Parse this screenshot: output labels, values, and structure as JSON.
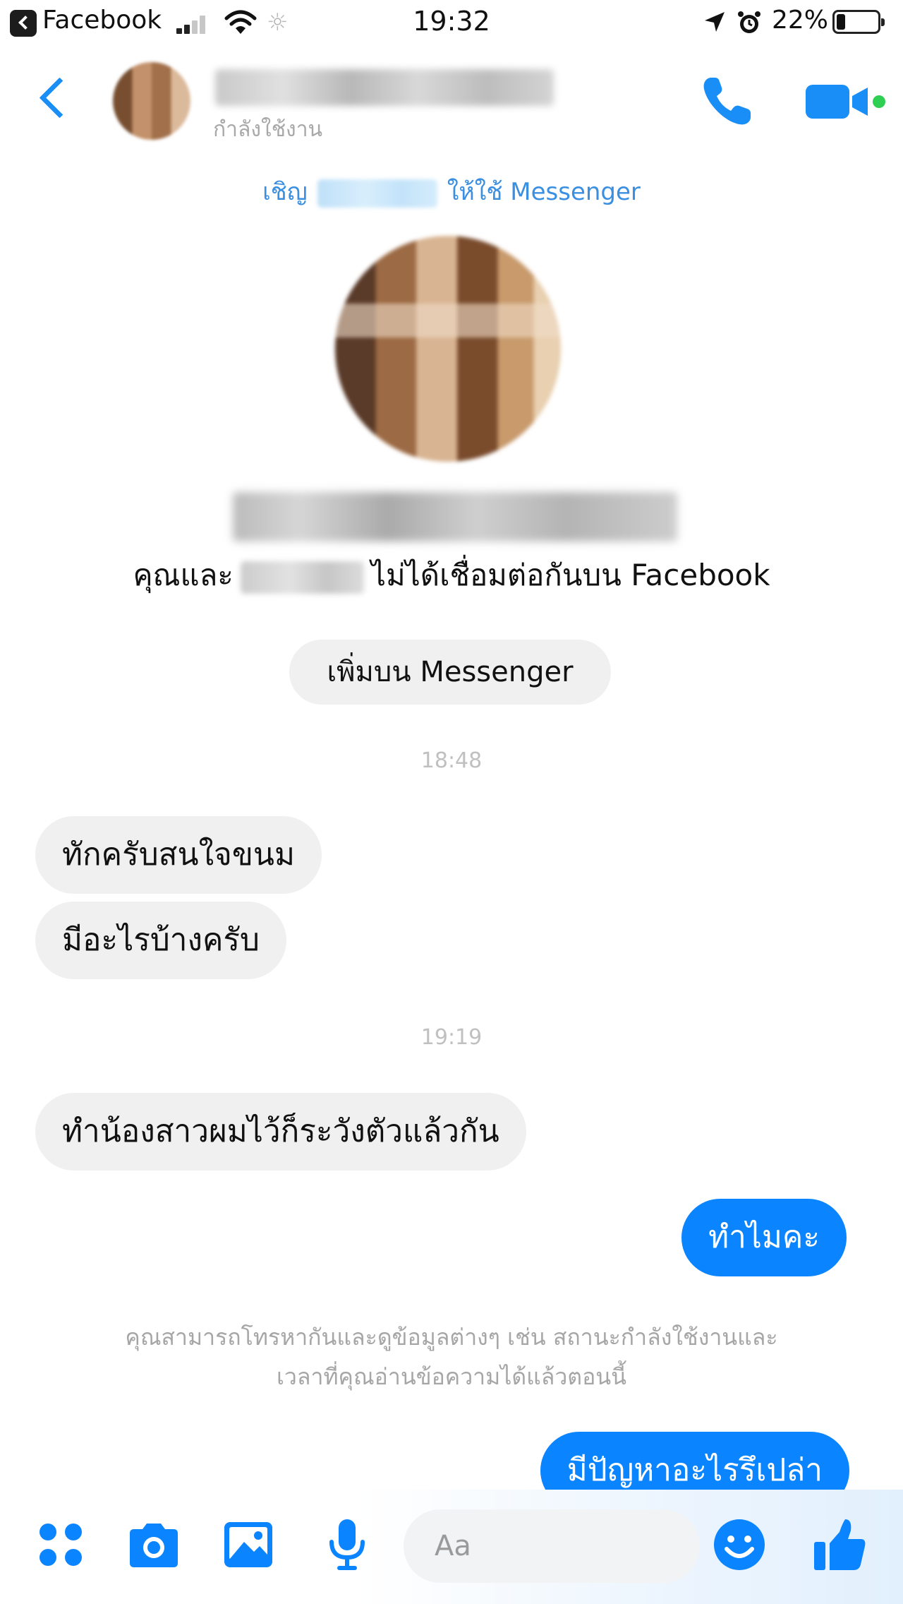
{
  "status_bar": {
    "app_name": "Facebook",
    "time": "19:32",
    "battery": "22%",
    "icons": [
      "back-to-app-icon",
      "signal-icon",
      "wifi-icon",
      "brightness-icon",
      "location-icon",
      "alarm-icon",
      "battery-icon"
    ]
  },
  "header": {
    "status": "กำลังใช้งาน",
    "icons": [
      "back-chevron-icon",
      "phone-icon",
      "video-camera-icon"
    ],
    "accent_color": "#1a8ef7",
    "active_dot_color": "#2fcf54"
  },
  "invite": {
    "before": "เชิญ",
    "after": "ให้ใช้ Messenger"
  },
  "profile": {
    "connection_before": "คุณและ",
    "connection_after": "ไม่ได้เชื่อมต่อกันบน Facebook",
    "add_button": "เพิ่มบน Messenger"
  },
  "conversation": {
    "timestamp_1": "18:48",
    "timestamp_2": "19:19",
    "messages": [
      {
        "from": "them",
        "text": "ทักครับสนใจขนม"
      },
      {
        "from": "them",
        "text": "มีอะไรบ้างครับ"
      },
      {
        "from": "them",
        "text": "ทำน้องสาวผมไว้ก็ระวังตัวแล้วกัน"
      },
      {
        "from": "me",
        "text": "ทำไมคะ"
      },
      {
        "from": "me",
        "text": "มีปัญหาอะไรรึเปล่า"
      }
    ],
    "info_line_1": "คุณสามารถโทรหากันและดูข้อมูลต่างๆ เช่น สถานะกำลังใช้งานและ",
    "info_line_2": "เวลาที่คุณอ่านข้อความได้แล้วตอนนี้",
    "outgoing_color": "#0b84ff",
    "incoming_color": "#f1f0f0"
  },
  "composer": {
    "placeholder": "Aa",
    "icons": [
      "apps-grid-icon",
      "camera-icon",
      "photo-gallery-icon",
      "microphone-icon",
      "emoji-icon",
      "thumbs-up-icon"
    ]
  }
}
